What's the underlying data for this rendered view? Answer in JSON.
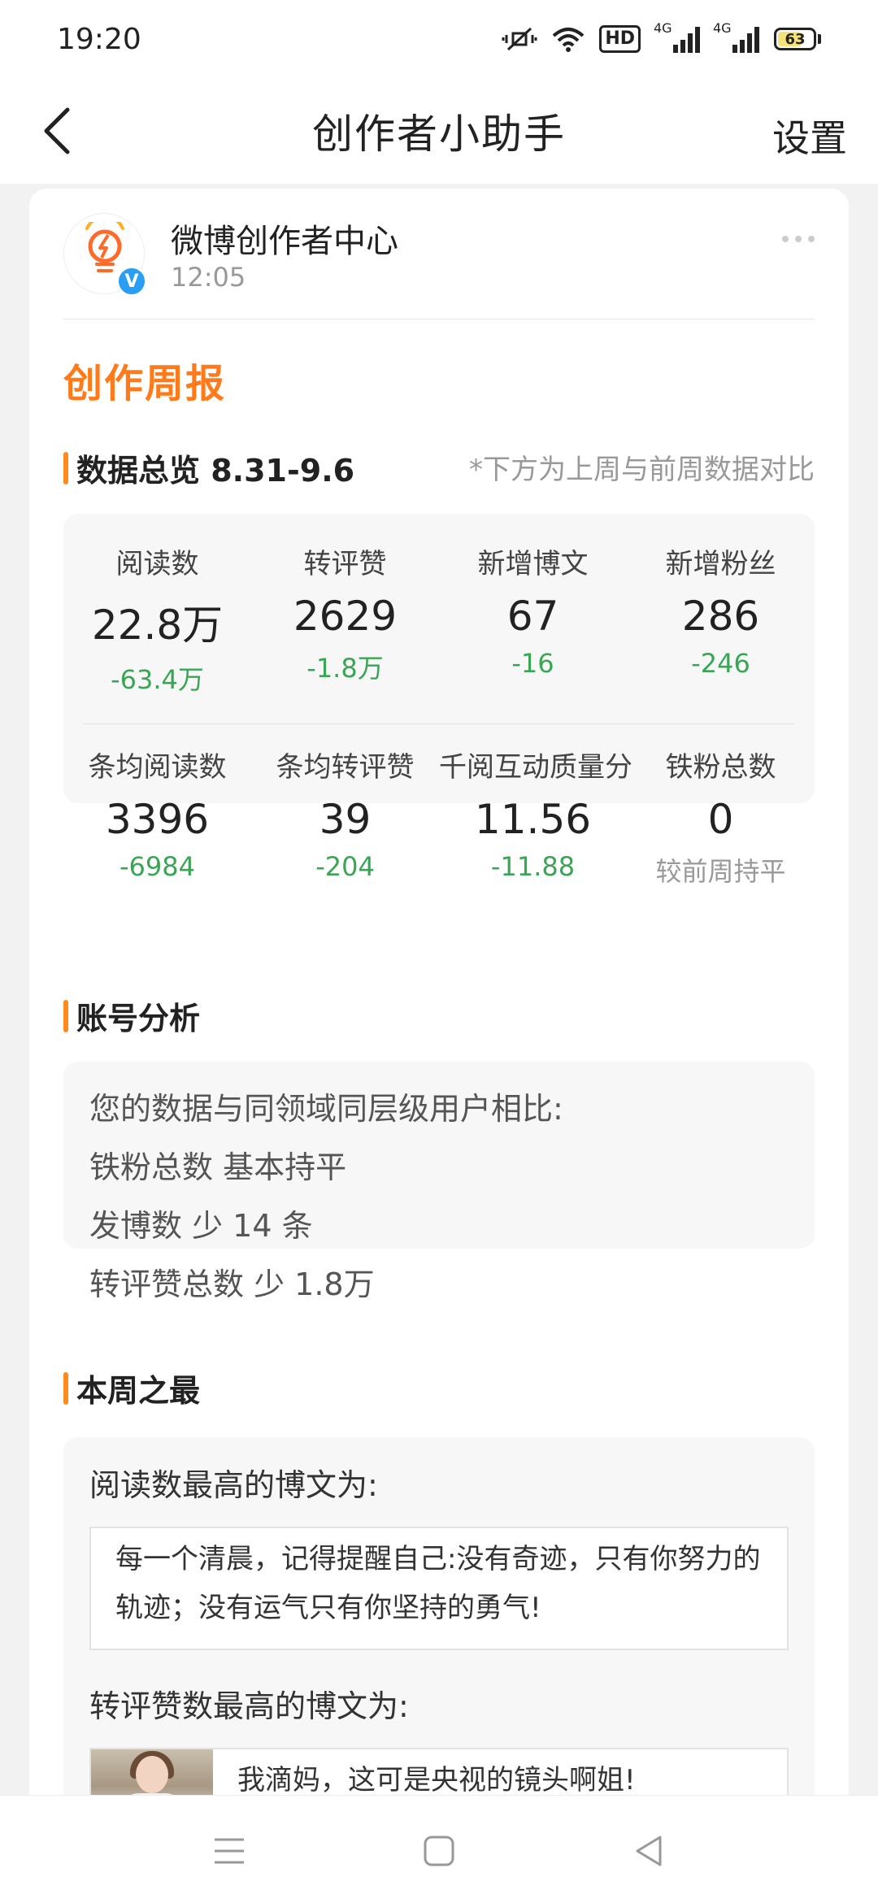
{
  "status_bar": {
    "time": "19:20",
    "network_1": "4G",
    "network_2": "4G",
    "hd_label": "HD",
    "battery": "63"
  },
  "nav": {
    "title": "创作者小助手",
    "settings": "设置"
  },
  "account": {
    "name": "微博创作者中心",
    "time": "12:05",
    "verified_mark": "V"
  },
  "report": {
    "title": "创作周报",
    "overview": {
      "heading": "数据总览 8.31-9.6",
      "note": "*下方为上周与前周数据对比",
      "row1": [
        {
          "label": "阅读数",
          "value": "22.8万",
          "change": "-63.4万"
        },
        {
          "label": "转评赞",
          "value": "2629",
          "change": "-1.8万"
        },
        {
          "label": "新增博文",
          "value": "67",
          "change": "-16"
        },
        {
          "label": "新增粉丝",
          "value": "286",
          "change": "-246"
        }
      ],
      "row2": [
        {
          "label": "条均阅读数",
          "value": "3396",
          "change": "-6984"
        },
        {
          "label": "条均转评赞",
          "value": "39",
          "change": "-204"
        },
        {
          "label": "千阅互动质量分",
          "value": "11.56",
          "change": "-11.88"
        },
        {
          "label": "铁粉总数",
          "value": "0",
          "change": "较前周持平"
        }
      ]
    },
    "analysis": {
      "heading": "账号分析",
      "lines": [
        "您的数据与同领域同层级用户相比:",
        "铁粉总数 基本持平",
        "发博数 少 14 条",
        "转评赞总数 少 1.8万"
      ]
    },
    "best": {
      "heading": "本周之最",
      "read_label": "阅读数最高的博文为:",
      "read_post": "每一个清晨，记得提醒自己:没有奇迹，只有你努力的轨迹；没有运气只有你坚持的勇气!",
      "interact_label": "转评赞数最高的博文为:",
      "interact_post": "我滴妈，这可是央视的镜头啊姐!"
    }
  },
  "colors": {
    "accent": "#ff7a1a",
    "positive_change": "#3aa655",
    "verified": "#2a9df4"
  }
}
